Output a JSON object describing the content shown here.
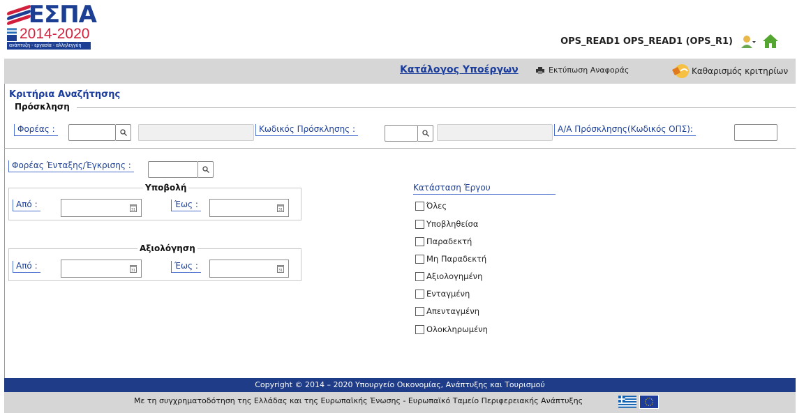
{
  "header": {
    "logo": {
      "word": "ΕΣΠΑ",
      "years": "2014-2020",
      "tagline": "ανάπτυξη - εργασία - αλληλεγγύη"
    },
    "user_label": "OPS_READ1 OPS_READ1 (OPS_R1)"
  },
  "toolbar": {
    "title": "Κατάλογος Υποέργων",
    "print_label": "Εκτύπωση Αναφοράς",
    "clear_label": "Καθαρισμός κριτηρίων"
  },
  "search": {
    "title": "Κριτήρια Αναζήτησης",
    "invitation_group": "Πρόσκληση",
    "agency_label": "Φορέας :",
    "agency_value": "",
    "invitation_code_label": "Κωδικός Πρόσκλησης :",
    "invitation_code_value": "",
    "aa_label": "Α/Α Πρόσκλησης(Κωδικός ΟΠΣ):",
    "aa_value": "",
    "inclusion_agency_label": "Φορέας Ένταξης/Έγκρισης :",
    "inclusion_agency_value": ""
  },
  "submission": {
    "group": "Υποβολή",
    "from_label": "Από :",
    "to_label": "Έως :",
    "from_value": "",
    "to_value": ""
  },
  "evaluation": {
    "group": "Αξιολόγηση",
    "from_label": "Από :",
    "to_label": "Έως :",
    "from_value": "",
    "to_value": ""
  },
  "status": {
    "title": "Κατάσταση Έργου",
    "options": [
      "Όλες",
      "Υποβληθείσα",
      "Παραδεκτή",
      "Μη Παραδεκτή",
      "Αξιολογημένη",
      "Ενταγμένη",
      "Απενταγμένη",
      "Ολοκληρωμένη"
    ]
  },
  "footer": {
    "copyright": "Copyright © 2014 – 2020 Υπουργείο Οικονομίας, Ανάπτυξης και Τουρισμού",
    "cofunding": "Με τη συγχρηματοδότηση της Ελλάδας και της Ευρωπαϊκής Ένωσης - Ευρωπαϊκό Ταμείο Περιφερειακής Ανάπτυξης"
  },
  "colors": {
    "accent": "#1a3c9c",
    "footer": "#1e3c88",
    "toolbar": "#d6d6d6",
    "logo_red": "#d21f3c"
  },
  "icons": [
    "search-icon",
    "calendar-icon",
    "print-icon",
    "eraser-icon",
    "user-icon",
    "home-icon",
    "greek-flag-icon",
    "eu-flag-icon"
  ]
}
